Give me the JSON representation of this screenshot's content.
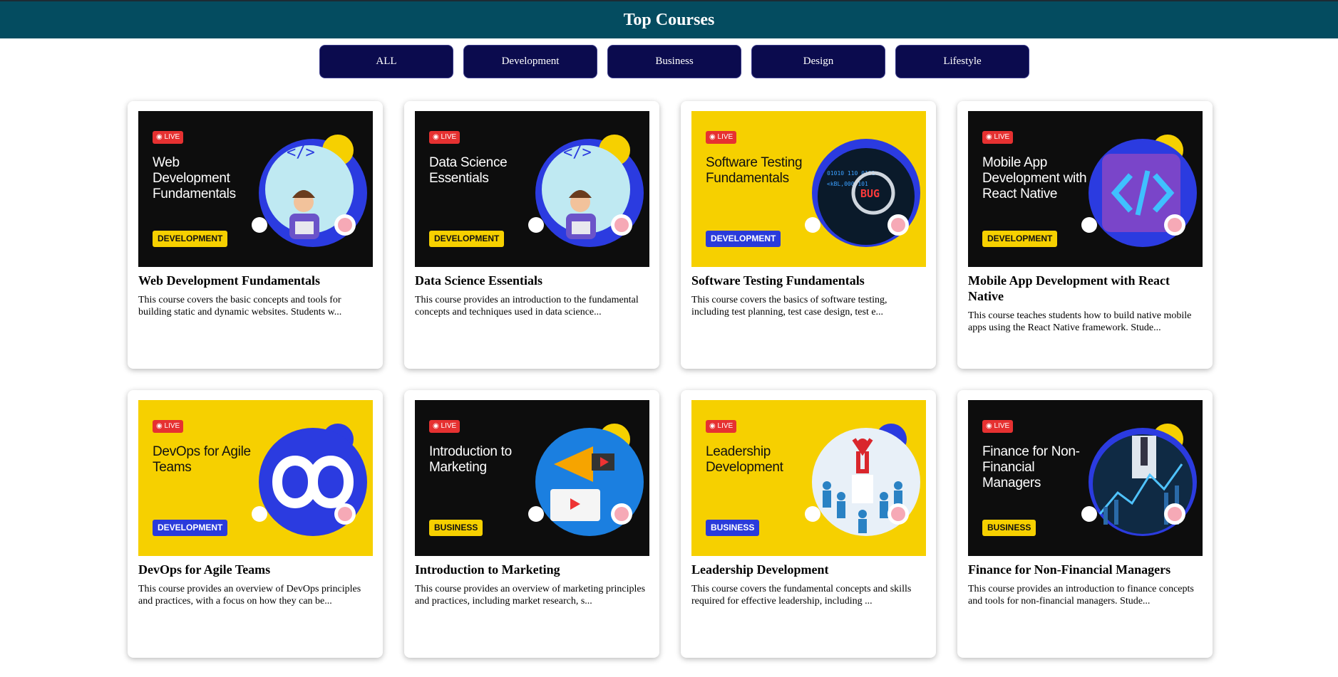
{
  "header": {
    "title": "Top Courses"
  },
  "filters": [
    "ALL",
    "Development",
    "Business",
    "Design",
    "Lifestyle"
  ],
  "live_label": "LIVE",
  "courses": [
    {
      "thumb_title": "Web Development Fundamentals",
      "category": "DEVELOPMENT",
      "title": "Web Development Fundamentals",
      "description": "This course covers the basic concepts and tools for building static and dynamic websites. Students w...",
      "theme": "dark",
      "art": "coder-icon"
    },
    {
      "thumb_title": "Data Science Essentials",
      "category": "DEVELOPMENT",
      "title": "Data Science Essentials",
      "description": "This course provides an introduction to the fundamental concepts and techniques used in data science...",
      "theme": "dark",
      "art": "coder-icon"
    },
    {
      "thumb_title": "Software Testing Fundamentals",
      "category": "DEVELOPMENT",
      "title": "Software Testing Fundamentals",
      "description": "This course covers the basics of software testing, including test planning, test case design, test e...",
      "theme": "yellow",
      "art": "bug-icon"
    },
    {
      "thumb_title": "Mobile App Development with React Native",
      "category": "DEVELOPMENT",
      "title": "Mobile App Development with React Native",
      "description": "This course teaches students how to build native mobile apps using the React Native framework. Stude...",
      "theme": "dark",
      "art": "code-brackets-icon"
    },
    {
      "thumb_title": "DevOps for Agile Teams",
      "category": "DEVELOPMENT",
      "title": "DevOps for Agile Teams",
      "description": "This course provides an overview of DevOps principles and practices, with a focus on how they can be...",
      "theme": "yellow",
      "art": "infinity-icon"
    },
    {
      "thumb_title": "Introduction to Marketing",
      "category": "BUSINESS",
      "title": "Introduction to Marketing",
      "description": "This course provides an overview of marketing principles and practices, including market research, s...",
      "theme": "dark",
      "art": "megaphone-icon"
    },
    {
      "thumb_title": "Leadership Development",
      "category": "BUSINESS",
      "title": "Leadership Development",
      "description": "This course covers the fundamental concepts and skills required for effective leadership, including ...",
      "theme": "yellow",
      "art": "leader-crowd-icon"
    },
    {
      "thumb_title": "Finance for Non-Financial Managers",
      "category": "BUSINESS",
      "title": "Finance for Non-Financial Managers",
      "description": "This course provides an introduction to finance concepts and tools for non-financial managers. Stude...",
      "theme": "dark",
      "art": "finance-chart-icon"
    }
  ]
}
